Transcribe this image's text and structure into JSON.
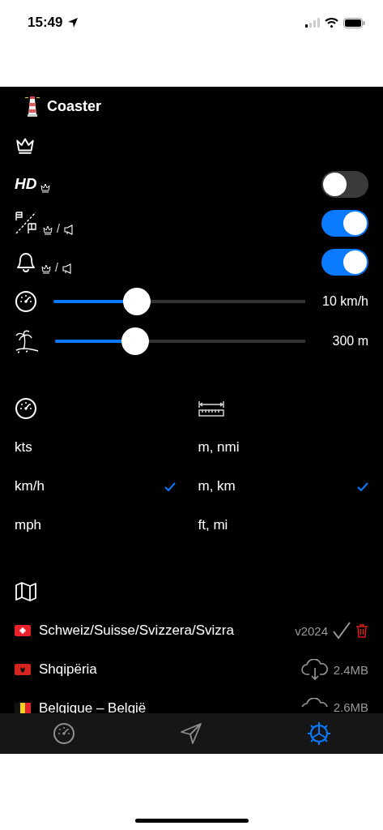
{
  "status_bar": {
    "time": "15:49"
  },
  "app": {
    "title": "Coaster"
  },
  "toggles": [
    {
      "kind": "hd",
      "label": "HD",
      "on": false
    },
    {
      "kind": "flags",
      "separator": "/",
      "on": true
    },
    {
      "kind": "bell",
      "separator": "/",
      "on": true
    }
  ],
  "sliders": [
    {
      "kind": "speed",
      "level": 0.33,
      "reading": "10 km/h"
    },
    {
      "kind": "beach",
      "level": 0.32,
      "reading": "300 m"
    }
  ],
  "speed_units": [
    {
      "label": "kts",
      "selected": false
    },
    {
      "label": "km/h",
      "selected": true
    },
    {
      "label": "mph",
      "selected": false
    }
  ],
  "distance_units": [
    {
      "label": "m, nmi",
      "selected": false
    },
    {
      "label": "m, km",
      "selected": true
    },
    {
      "label": "ft, mi",
      "selected": false
    }
  ],
  "maps": [
    {
      "kind": "ch",
      "name": "Schweiz/Suisse/Svizzera/Svizra",
      "installed": true,
      "version": "v2024"
    },
    {
      "kind": "al",
      "name": "Shqipëria",
      "installed": false,
      "size": "2.4MB"
    },
    {
      "kind": "be",
      "name": "Belgique – België",
      "installed": false,
      "size": "2.6MB"
    }
  ],
  "tabs": [
    {
      "kind": "speed",
      "selected": false
    },
    {
      "kind": "navigate",
      "selected": false
    },
    {
      "kind": "settings",
      "selected": true
    }
  ]
}
